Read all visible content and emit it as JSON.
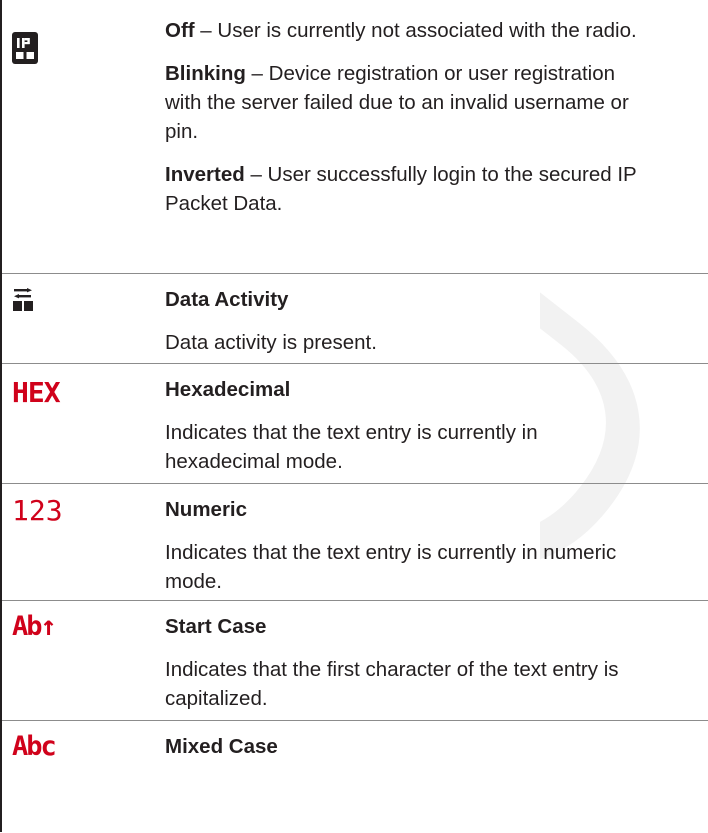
{
  "rows": [
    {
      "icon": "ip-secured-icon",
      "paras": [
        {
          "term": "Off",
          "text": " – User is currently not associated with the radio."
        },
        {
          "term": "Blinking",
          "text": " – Device registration or user registration with the server failed due to an invalid username or pin."
        },
        {
          "term": "Inverted",
          "text": " – User successfully login to the secured IP Packet Data."
        }
      ]
    },
    {
      "icon": "data-activity-icon",
      "title": "Data Activity",
      "desc": "Data activity is present."
    },
    {
      "icon": "hex-mode-icon",
      "icon_text": "HEX",
      "title": "Hexadecimal",
      "desc": "Indicates that the text entry is currently in hexadecimal mode."
    },
    {
      "icon": "numeric-mode-icon",
      "icon_text": "123",
      "title": "Numeric",
      "desc": "Indicates that the text entry is currently in numeric mode."
    },
    {
      "icon": "start-case-icon",
      "icon_text": "Ab↑",
      "title": "Start Case",
      "desc": "Indicates that the first character of the text entry is capitalized."
    },
    {
      "icon": "mixed-case-icon",
      "icon_text": "Abc",
      "title": "Mixed Case"
    }
  ],
  "colors": {
    "icon_red": "#d0021b",
    "text": "#231f20",
    "rule": "#8c8c8c"
  }
}
